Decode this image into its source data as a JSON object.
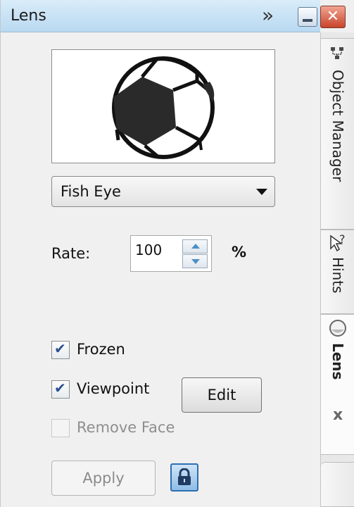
{
  "window": {
    "title": "Lens",
    "collapse_glyph": "»",
    "close_glyph": "✕"
  },
  "lens": {
    "preview_icon": "soccer-ball-preview",
    "type_selected": "Fish Eye",
    "rate_label": "Rate:",
    "rate_value": "100",
    "rate_unit": "%",
    "options": [
      {
        "label": "Frozen",
        "checked": true,
        "enabled": true
      },
      {
        "label": "Viewpoint",
        "checked": true,
        "enabled": true
      },
      {
        "label": "Remove Face",
        "checked": false,
        "enabled": false
      }
    ],
    "edit_label": "Edit",
    "apply_label": "Apply",
    "lock_icon": "lock-icon"
  },
  "dock_tabs": [
    {
      "label": "Object Manager",
      "icon": "object-manager-icon"
    },
    {
      "label": "Hints",
      "icon": "hints-icon"
    },
    {
      "label": "Lens",
      "icon": "lens-icon",
      "active": true
    }
  ],
  "dock_close_glyph": "x"
}
